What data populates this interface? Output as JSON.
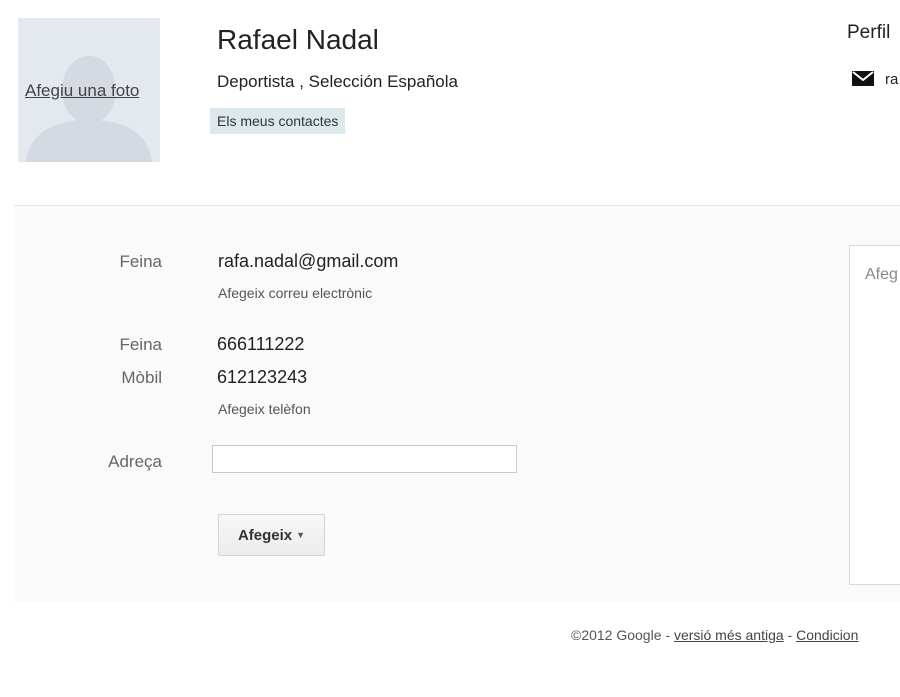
{
  "contact": {
    "photo_link": "Afegiu una foto",
    "name": "Rafael Nadal",
    "subtitle": "Deportista ,  Selección Española",
    "group_badge": "Els meus contactes"
  },
  "profile": {
    "title": "Perfil",
    "email_snippet": "ra",
    "icon": "mail-icon"
  },
  "details": {
    "email": {
      "label": "Feina",
      "value": "rafa.nadal@gmail.com",
      "add_link": "Afegeix correu electrònic"
    },
    "phones": [
      {
        "label": "Feina",
        "value": "666111222"
      },
      {
        "label": "Mòbil",
        "value": "612123243"
      }
    ],
    "add_phone_link": "Afegeix telèfon",
    "address": {
      "label": "Adreça",
      "value": ""
    },
    "add_button": {
      "label": "Afegeix"
    }
  },
  "notes": {
    "placeholder": "Afeg"
  },
  "footer": {
    "copyright": "©2012 Google - ",
    "old_version_link": "versió més antiga",
    "separator": " - ",
    "terms_link": "Condicion"
  }
}
